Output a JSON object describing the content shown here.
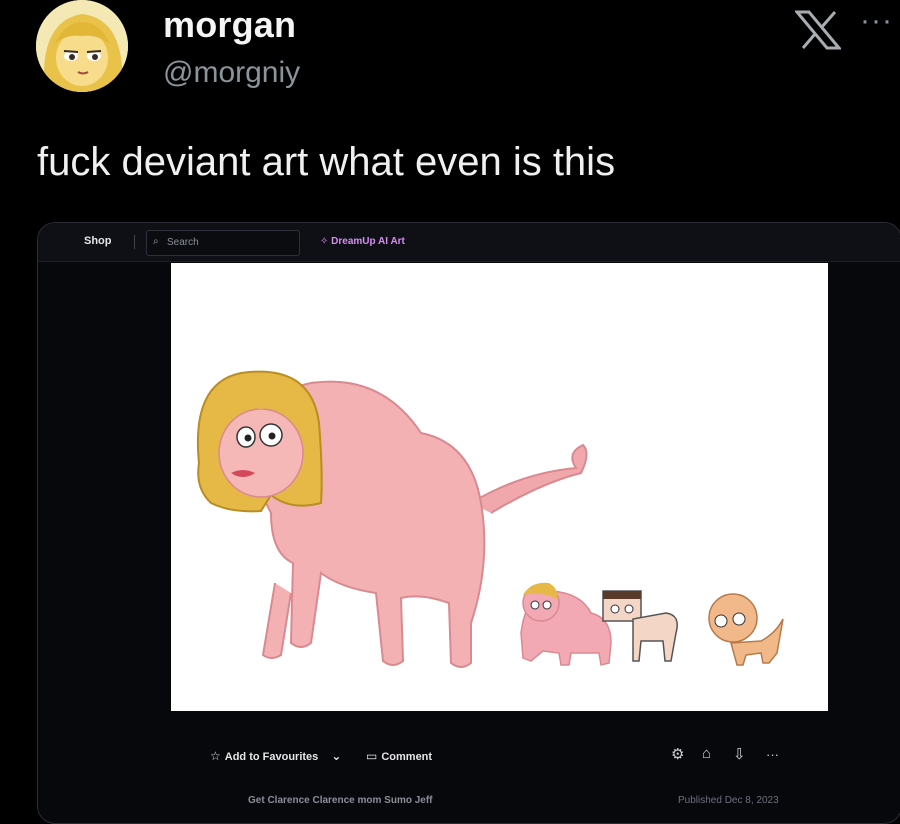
{
  "tweet": {
    "display_name": "morgan",
    "handle": "@morgniy",
    "text": "fuck deviant art what even is this",
    "avatar_icon": "anime-avatar-icon",
    "platform_icon": "x-logo-icon",
    "more_icon": "more-options-icon",
    "more_symbol": "···"
  },
  "embedded": {
    "topbar": {
      "shop_label": "Shop",
      "search_placeholder": "Search",
      "dreamup_label": "DreamUp AI Art"
    },
    "artwork_icon": "cartoon-creature-family-illustration",
    "actions": {
      "favourite_label": "Add to Favourites",
      "comment_label": "Comment",
      "more_symbol": "···"
    },
    "footer": {
      "title_text": "Get Clarence Clarence mom Sumo Jeff",
      "date_text": "Published Dec 8, 2023"
    },
    "colors": {
      "accent": "#d88cf0",
      "card_bg": "#07080c"
    }
  }
}
